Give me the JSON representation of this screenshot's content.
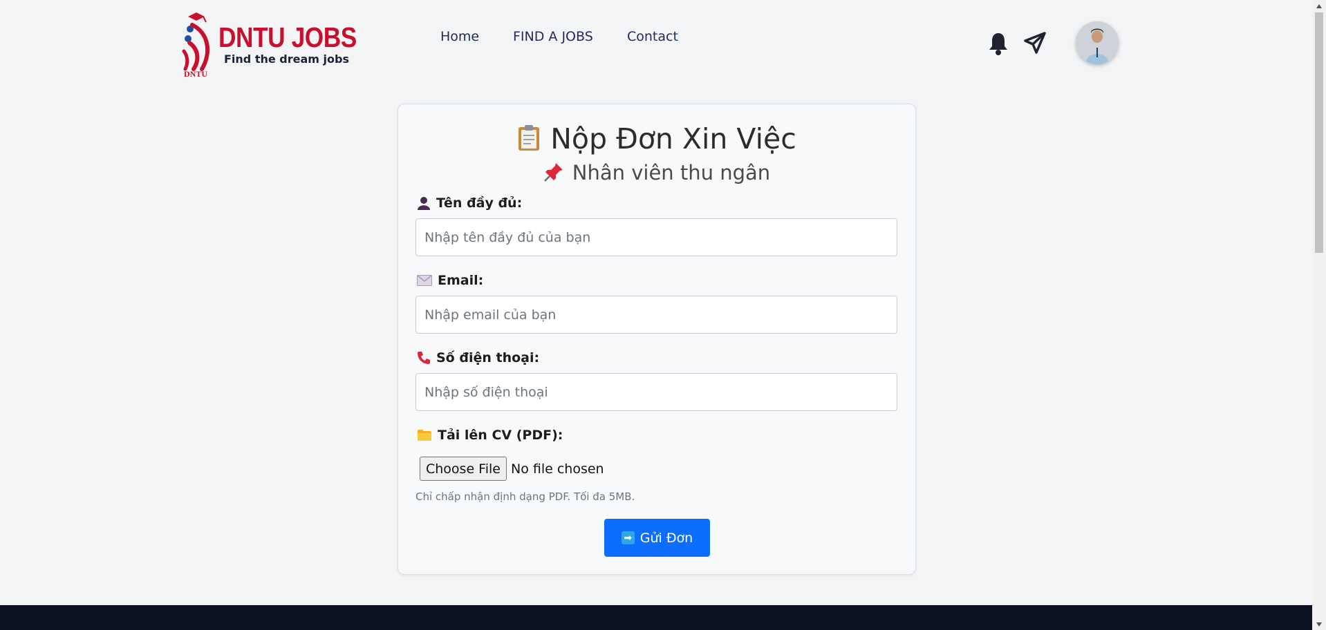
{
  "brand": {
    "name": "DNTU JOBS",
    "tagline": "Find the dream jobs",
    "mark": "DNTU"
  },
  "nav": {
    "items": [
      {
        "label": "Home"
      },
      {
        "label": "FIND A JOBS"
      },
      {
        "label": "Contact"
      }
    ]
  },
  "header_icons": [
    "bell-icon",
    "send-icon",
    "avatar"
  ],
  "form": {
    "title": "Nộp Đơn Xin Việc",
    "subtitle": "Nhân viên thu ngân",
    "name": {
      "label": "Tên đầy đủ:",
      "placeholder": "Nhập tên đầy đủ của bạn",
      "value": ""
    },
    "email": {
      "label": "Email:",
      "placeholder": "Nhập email của bạn",
      "value": ""
    },
    "phone": {
      "label": "Số điện thoại:",
      "placeholder": "Nhập số điện thoại",
      "value": ""
    },
    "cv": {
      "label": "Tải lên CV (PDF):",
      "button_label": "Choose File",
      "status": "No file chosen",
      "hint": "Chỉ chấp nhận định dạng PDF. Tối đa 5MB."
    },
    "submit_label": "Gửi Đơn"
  },
  "colors": {
    "brand_red": "#c8102e",
    "primary_button": "#0d6efd",
    "nav_text": "#1d2a5b",
    "page_bg": "#f3f4f6",
    "footer_bg": "#0b1120"
  }
}
